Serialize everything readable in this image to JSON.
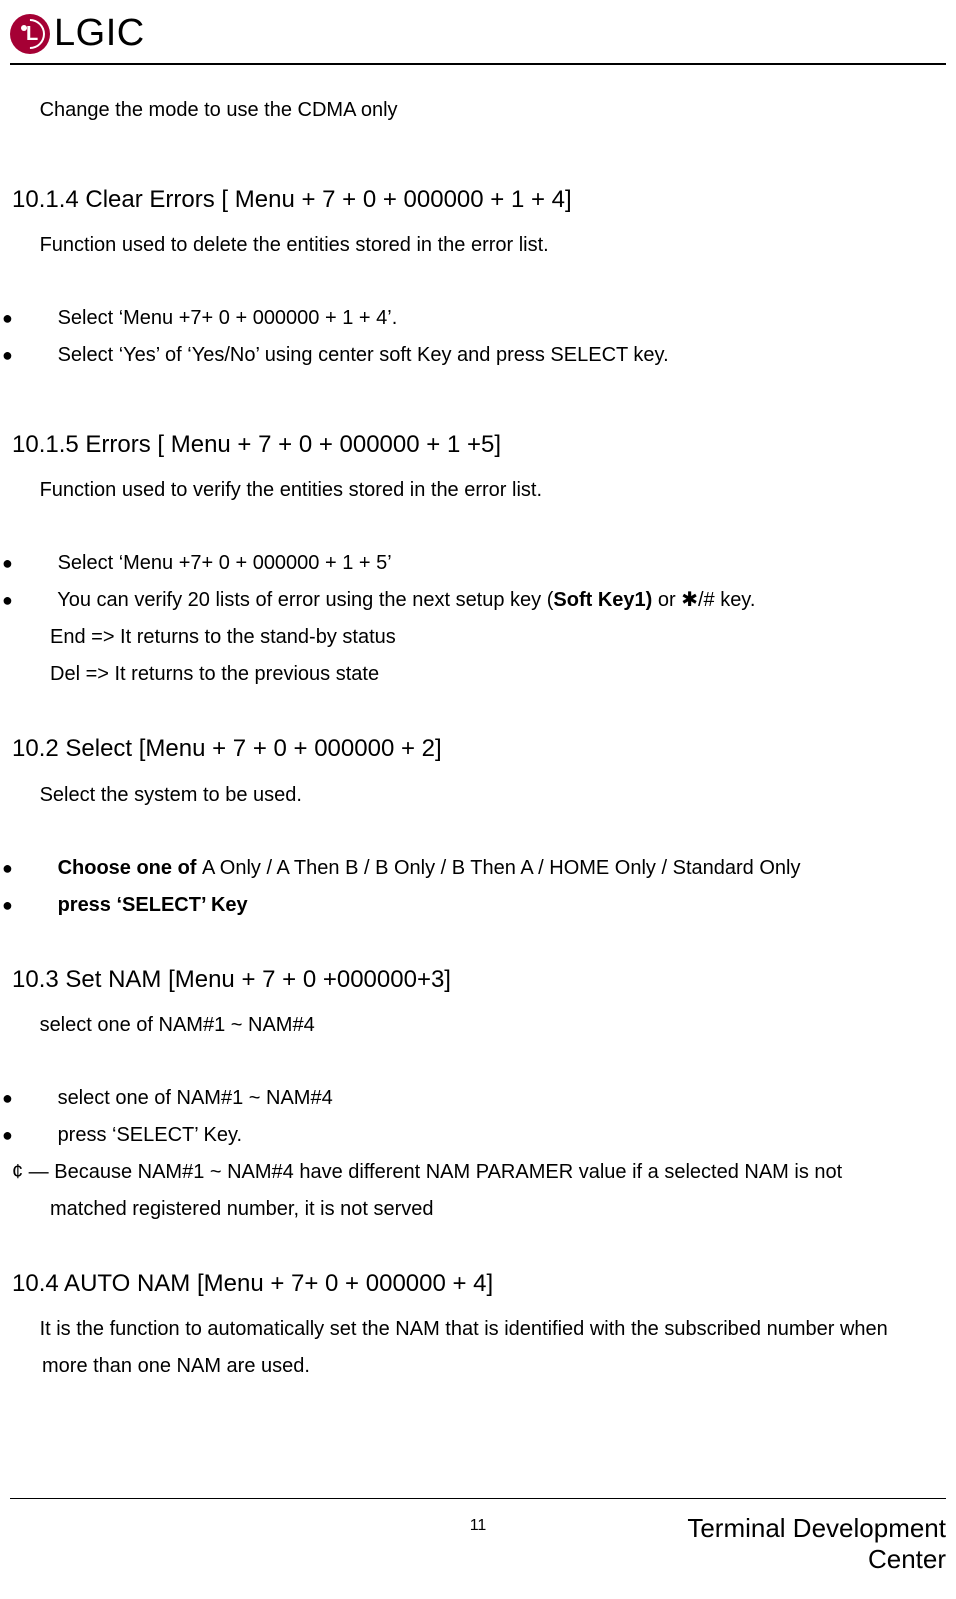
{
  "brand": "LGIC",
  "intro_line": "Change the mode to use the CDMA only",
  "sec_10_1_4": {
    "title": "10.1.4 Clear Errors [ Menu + 7 + 0 + 000000 + 1 + 4]",
    "desc": "Function used to delete the entities stored in the error list.",
    "b1": "Select ‘Menu +7+ 0 + 000000 + 1 + 4’.",
    "b2": "Select ‘Yes’ of ‘Yes/No’ using center soft Key and press SELECT key."
  },
  "sec_10_1_5": {
    "title": "10.1.5 Errors [ Menu + 7 + 0 + 000000 + 1 +5]",
    "desc": "Function used to verify the entities stored in the error list.",
    "b1": "Select ‘Menu +7+ 0 + 000000 + 1 + 5’",
    "b2_pre": "You can verify 20 lists of error using the next setup key (",
    "b2_bold": "Soft Key1)",
    "b2_post": " or ✱/# key.",
    "sub1": "End => It returns to the stand-by status",
    "sub2": "Del => It returns to the previous state"
  },
  "sec_10_2": {
    "title": "10.2 Select [Menu + 7 + 0 + 000000 + 2]",
    "desc": "Select the system to be used.",
    "b1_bold": "Choose one of ",
    "b1_rest": "A Only / A Then B / B Only / B Then A / HOME Only / Standard Only",
    "b2_bold": "press ‘SELECT’ Key"
  },
  "sec_10_3": {
    "title": "10.3 Set NAM [Menu + 7 + 0 +000000+3]",
    "desc": "select one of NAM#1 ~ NAM#4",
    "b1": "select one of NAM#1 ~ NAM#4",
    "b2": "press ‘SELECT’ Key.",
    "note_pre": "¢ — Because NAM#1 ~ NAM#4 have different NAM PARAMER value   if a selected NAM is not",
    "note_line2": "matched registered number,   it is not served"
  },
  "sec_10_4": {
    "title": "10.4 AUTO NAM   [Menu + 7+ 0 + 000000 + 4]",
    "desc": "It is the function to automatically set the NAM that is identified with the subscribed number when",
    "desc2": "more than one NAM are used."
  },
  "footer": {
    "page": "11",
    "right": "Terminal Development Center"
  },
  "icons": {
    "pointer": "☛",
    "dot": "●"
  }
}
